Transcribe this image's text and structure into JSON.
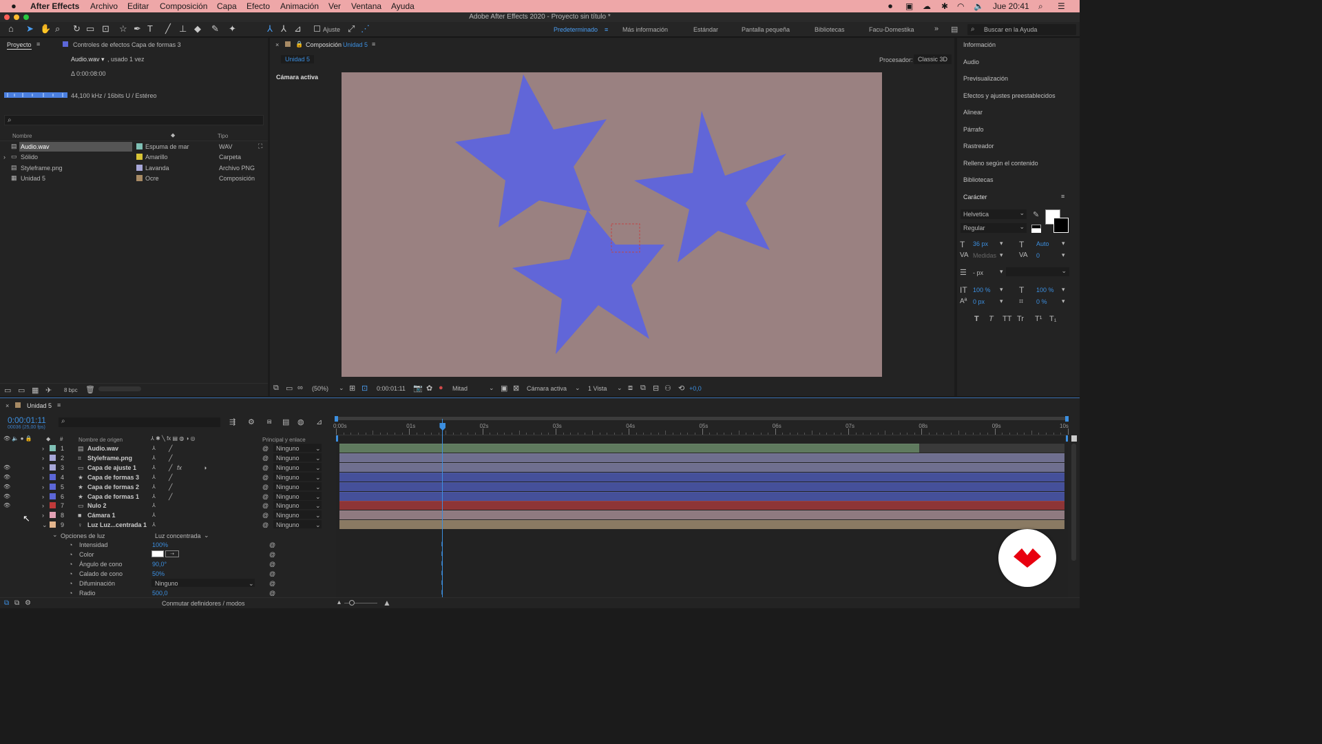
{
  "menubar": {
    "apple": "",
    "app": "After Effects",
    "items": [
      "Archivo",
      "Editar",
      "Composición",
      "Capa",
      "Efecto",
      "Animación",
      "Ver",
      "Ventana",
      "Ayuda"
    ],
    "clock": "Jue 20:41"
  },
  "window": {
    "title": "Adobe After Effects 2020 - Proyecto sin título *"
  },
  "toolbar": {
    "snap_label": "Ajuste",
    "workspaces": [
      "Predeterminado",
      "Más información",
      "Estándar",
      "Pantalla pequeña",
      "Bibliotecas",
      "Facu-Domestika"
    ],
    "search_placeholder": "Buscar en la Ayuda"
  },
  "project": {
    "tab": "Proyecto",
    "effects_tab": "Controles de efectos Capa de formas 3",
    "asset_name": "Audio.wav ▾",
    "asset_usage": ", usado 1 vez",
    "duration": "Δ 0:00:08:00",
    "audio_info": "44,100 kHz / 16bits U / Estéreo",
    "headers": {
      "name": "Nombre",
      "type": "Tipo"
    },
    "items": [
      {
        "name": "Audio.wav",
        "label": "Espuma de mar",
        "type": "WAV",
        "color": "#7fc0b5"
      },
      {
        "name": "Sólido",
        "label": "Amarillo",
        "type": "Carpeta",
        "color": "#d8c436"
      },
      {
        "name": "Styleframe.png",
        "label": "Lavanda",
        "type": "Archivo PNG",
        "color": "#a7a7d8"
      },
      {
        "name": "Unidad 5",
        "label": "Ocre",
        "type": "Composición",
        "color": "#a78a64"
      }
    ],
    "bpc": "8 bpc"
  },
  "comp": {
    "tab_prefix": "Composición",
    "tab_name": "Unidad 5",
    "subtab": "Unidad 5",
    "renderer_label": "Procesador:",
    "renderer": "Classic 3D",
    "camera_label": "Cámara activa",
    "bg_color": "#9a8181",
    "star_color": "#6166d8",
    "footer": {
      "zoom": "(50%)",
      "time": "0:00:01:11",
      "resolution": "Mitad",
      "camera": "Cámara activa",
      "views": "1 Vista",
      "exposure": "+0,0"
    }
  },
  "right_panel": {
    "items": [
      "Información",
      "Audio",
      "Previsualización",
      "Efectos y ajustes preestablecidos",
      "Alinear",
      "Párrafo",
      "Rastreador",
      "Relleno según el contenido",
      "Bibliotecas"
    ],
    "character": {
      "title": "Carácter",
      "font": "Helvetica",
      "style": "Regular",
      "size": "36 px",
      "leading": "Auto",
      "kerning": "Medidas",
      "tracking": "0",
      "stroke": "- px",
      "vscale": "100 %",
      "hscale": "100 %",
      "baseline": "0 px",
      "tsume": "0 %",
      "styles": [
        "T",
        "T",
        "TT",
        "Tr",
        "T¹",
        "T₁"
      ]
    }
  },
  "timeline": {
    "tab": "Unidad 5",
    "timecode": "0:00:01:11",
    "fps": "00036 (25,00 fps)",
    "col_name": "Nombre de origen",
    "col_parent": "Principal y enlace",
    "ruler": [
      "0:00s",
      "01s",
      "02s",
      "03s",
      "04s",
      "05s",
      "06s",
      "07s",
      "08s",
      "09s",
      "10s"
    ],
    "playhead_fraction": 0.1453,
    "layers": [
      {
        "num": "1",
        "name": "Audio.wav",
        "color": "#7fc0b5",
        "parent": "Ninguno",
        "bar": "#5f7a5e",
        "bar_end": 0.8
      },
      {
        "num": "2",
        "name": "Styleframe.png",
        "color": "#a7a7d8",
        "parent": "Ninguno",
        "bar": "#6f6f8f",
        "bar_end": 1
      },
      {
        "num": "3",
        "name": "Capa de ajuste 1",
        "color": "#a7a7d8",
        "parent": "Ninguno",
        "bar": "#6f6f8f",
        "bar_end": 1
      },
      {
        "num": "4",
        "name": "Capa de formas 3",
        "color": "#5c67d8",
        "parent": "Ninguno",
        "bar": "#45509a",
        "bar_end": 1
      },
      {
        "num": "5",
        "name": "Capa de formas 2",
        "color": "#5c67d8",
        "parent": "Ninguno",
        "bar": "#45509a",
        "bar_end": 1
      },
      {
        "num": "6",
        "name": "Capa de formas 1",
        "color": "#5c67d8",
        "parent": "Ninguno",
        "bar": "#45509a",
        "bar_end": 1
      },
      {
        "num": "7",
        "name": "Nulo 2",
        "color": "#c03a3a",
        "parent": "Ninguno",
        "bar": "#8e3536",
        "bar_end": 1
      },
      {
        "num": "8",
        "name": "Cámara 1",
        "color": "#e2a0b4",
        "parent": "Ninguno",
        "bar": "#8f7a80",
        "bar_end": 1
      },
      {
        "num": "9",
        "name": "Luz Luz...centrada 1",
        "color": "#e3b58d",
        "parent": "Ninguno",
        "bar": "#8a7a63",
        "bar_end": 1
      }
    ],
    "light_group": "Opciones de luz",
    "light_type": "Luz concentrada",
    "light_props": [
      {
        "name": "Intensidad",
        "value": "100%"
      },
      {
        "name": "Color",
        "value": ""
      },
      {
        "name": "Ángulo de cono",
        "value": "90,0°"
      },
      {
        "name": "Calado de cono",
        "value": "50%"
      },
      {
        "name": "Difuminación",
        "value": "Ninguno"
      },
      {
        "name": "Radio",
        "value": "500,0"
      }
    ],
    "footer": "Conmutar definidores / modos"
  }
}
